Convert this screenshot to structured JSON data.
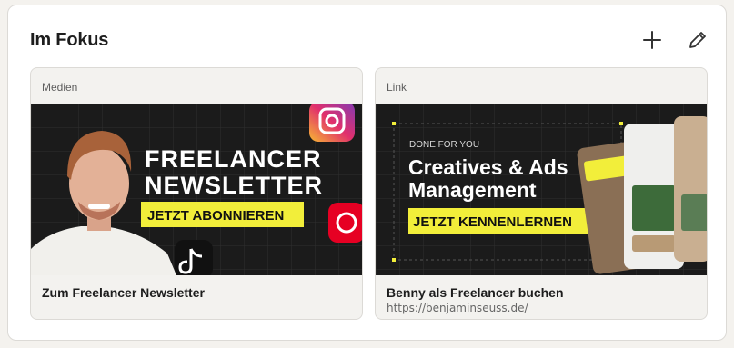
{
  "section": {
    "title": "Im Fokus",
    "add_icon": "plus-icon",
    "edit_icon": "pencil-icon"
  },
  "cards": [
    {
      "type_label": "Medien",
      "title": "Zum Freelancer Newsletter",
      "banner": {
        "headline_1": "FREELANCER",
        "headline_2": "NEWSLETTER",
        "cta": "JETZT ABONNIEREN",
        "icons": [
          "instagram-icon",
          "pinterest-icon",
          "tiktok-icon"
        ]
      }
    },
    {
      "type_label": "Link",
      "title": "Benny als Freelancer buchen",
      "url": "https://benjaminseuss.de/",
      "banner": {
        "kicker": "DONE FOR YOU",
        "headline_1": "Creatives & Ads",
        "headline_2": "Management",
        "cta": "JETZT KENNENLERNEN"
      }
    }
  ],
  "colors": {
    "accent_yellow": "#f2ee3a",
    "banner_bg": "#1b1b1b"
  }
}
